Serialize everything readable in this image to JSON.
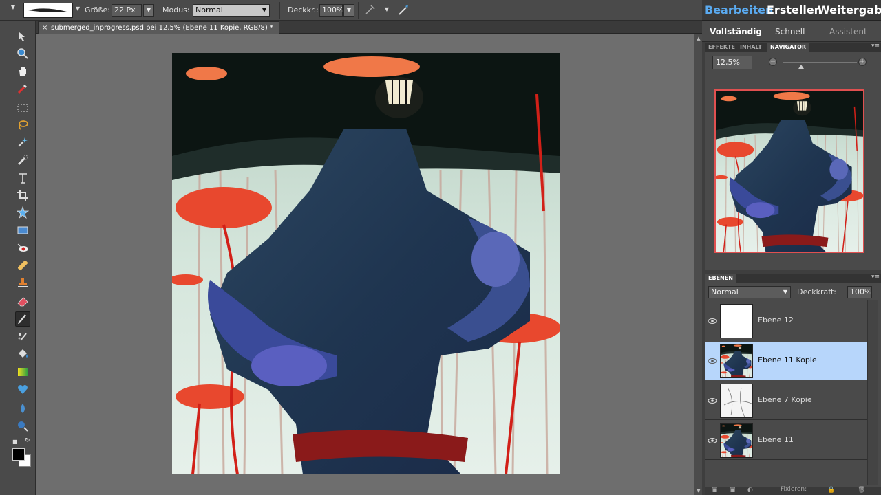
{
  "options_bar": {
    "size_label": "Größe:",
    "size_value": "22 Px",
    "mode_label": "Modus:",
    "mode_value": "Normal",
    "opacity_label": "Deckkr.:",
    "opacity_value": "100%"
  },
  "document": {
    "tab_title": "submerged_inprogress.psd bei 12,5% (Ebene 11 Kopie, RGB/8) *"
  },
  "mode_tabs": [
    "Bearbeiten",
    "Erstellen",
    "Weitergab"
  ],
  "sub_tabs": [
    "Vollständig",
    "Schnell",
    "Assistent"
  ],
  "panel_tabs": [
    "EFFEKTE",
    "INHALT",
    "NAVIGATOR"
  ],
  "navigator": {
    "zoom": "12,5%",
    "zoom_out": "−",
    "zoom_in": "+"
  },
  "layers": {
    "title": "EBENEN",
    "blend_mode": "Normal",
    "opacity_label": "Deckkraft:",
    "opacity_value": "100%",
    "items": [
      {
        "name": "Ebene 12",
        "selected": false
      },
      {
        "name": "Ebene 11 Kopie",
        "selected": true
      },
      {
        "name": "Ebene 7 Kopie",
        "selected": false
      },
      {
        "name": "Ebene 11",
        "selected": false
      }
    ],
    "footer_label": "Fixieren:"
  },
  "colors": {
    "foreground": "#000000",
    "background": "#ffffff",
    "selection": "#b7d6fb",
    "navigator_frame": "#e05050"
  },
  "tools": [
    "move-tool",
    "zoom-tool",
    "hand-tool",
    "eyedropper-tool",
    "marquee-tool",
    "lasso-tool",
    "magic-wand-tool",
    "quick-selection-tool",
    "type-tool",
    "crop-tool",
    "custom-shape-tool",
    "recompose-tool",
    "red-eye-tool",
    "healing-brush-tool",
    "clone-stamp-tool",
    "eraser-tool",
    "brush-tool",
    "smart-brush-tool",
    "paint-bucket-tool",
    "gradient-tool",
    "shape-tool",
    "blur-tool",
    "sponge-tool"
  ]
}
